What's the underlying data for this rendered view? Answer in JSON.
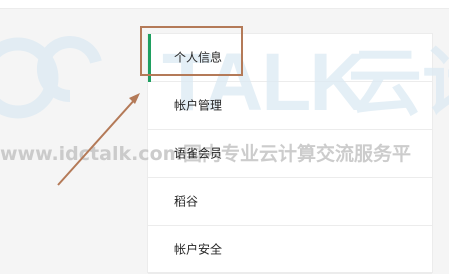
{
  "menu": {
    "items": [
      {
        "label": "个人信息",
        "active": true
      },
      {
        "label": "帐户管理",
        "active": false
      },
      {
        "label": "语雀会员",
        "active": false
      },
      {
        "label": "稻谷",
        "active": false
      },
      {
        "label": "帐户安全",
        "active": false
      }
    ]
  },
  "watermark": {
    "brand": "TALK",
    "brand_cn": "云计",
    "url": "www.idctalk.com",
    "tagline": "国内专业云计算交流服务平"
  },
  "colors": {
    "active_indicator": "#1f9f60",
    "annotation": "#b47a58",
    "watermark": "#dceaf3",
    "watermark_text": "#c4c4c4"
  }
}
